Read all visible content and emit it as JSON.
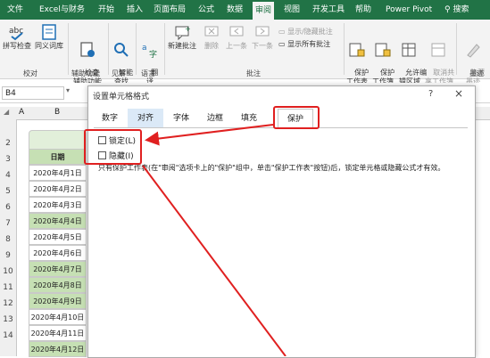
{
  "ribbon_tabs": [
    "文件",
    "Excel与财务",
    "开始",
    "插入",
    "页面布局",
    "公式",
    "数据",
    "审阅",
    "视图",
    "开发工具",
    "帮助",
    "Power Pivot",
    "搜索"
  ],
  "ribbon": {
    "proofing_group": "校对",
    "spell_check": "拼写检查",
    "thesaurus": "同义词库",
    "check_accessibility": "检查\n辅助功能",
    "accessibility_group": "辅助功能",
    "smart_lookup": "智能\n查找",
    "insights_group": "见解",
    "translate": "翻\n译",
    "language_group": "语言",
    "new_comment": "新建批注",
    "delete": "删除",
    "previous": "上一条",
    "next": "下一条",
    "show_hide_comment": "显示/隐藏批注",
    "show_all_comments": "显示所有批注",
    "comments_group": "批注",
    "protect_sheet": "保护\n工作表",
    "protect_workbook": "保护\n工作簿",
    "allow_edit_ranges": "允许编\n辑区域",
    "unshare_workbook": "取消共\n享工作簿",
    "hide_ink": "隐藏\n墨迹",
    "ink_group": "墨迹"
  },
  "name_box": "B4",
  "column_headers": [
    "A",
    "B"
  ],
  "row_numbers": [
    "1",
    "2",
    "3",
    "4",
    "5",
    "6",
    "7",
    "8",
    "9",
    "10",
    "11",
    "12",
    "13",
    "14"
  ],
  "sheet": {
    "header": "日期",
    "dates": [
      "2020年4月1日",
      "2020年4月2日",
      "2020年4月3日",
      "2020年4月4日",
      "2020年4月5日",
      "2020年4月6日",
      "2020年4月7日",
      "2020年4月8日",
      "2020年4月9日",
      "2020年4月10日",
      "2020年4月11日",
      "2020年4月12日"
    ]
  },
  "dialog": {
    "title": "设置单元格格式",
    "help": "?",
    "close": "×",
    "tabs": [
      "数字",
      "对齐",
      "字体",
      "边框",
      "填充",
      "保护"
    ],
    "locked_label": "锁定(L)",
    "hidden_label": "隐藏(I)",
    "note": "只有保护工作表(在\"审阅\"选项卡上的\"保护\"组中，单击\"保护工作表\"按钮)后，锁定单元格或隐藏公式才有效。"
  },
  "colors": {
    "excel_green": "#217346",
    "highlight_red": "#e02020",
    "row_green": "#c6e0b4"
  }
}
